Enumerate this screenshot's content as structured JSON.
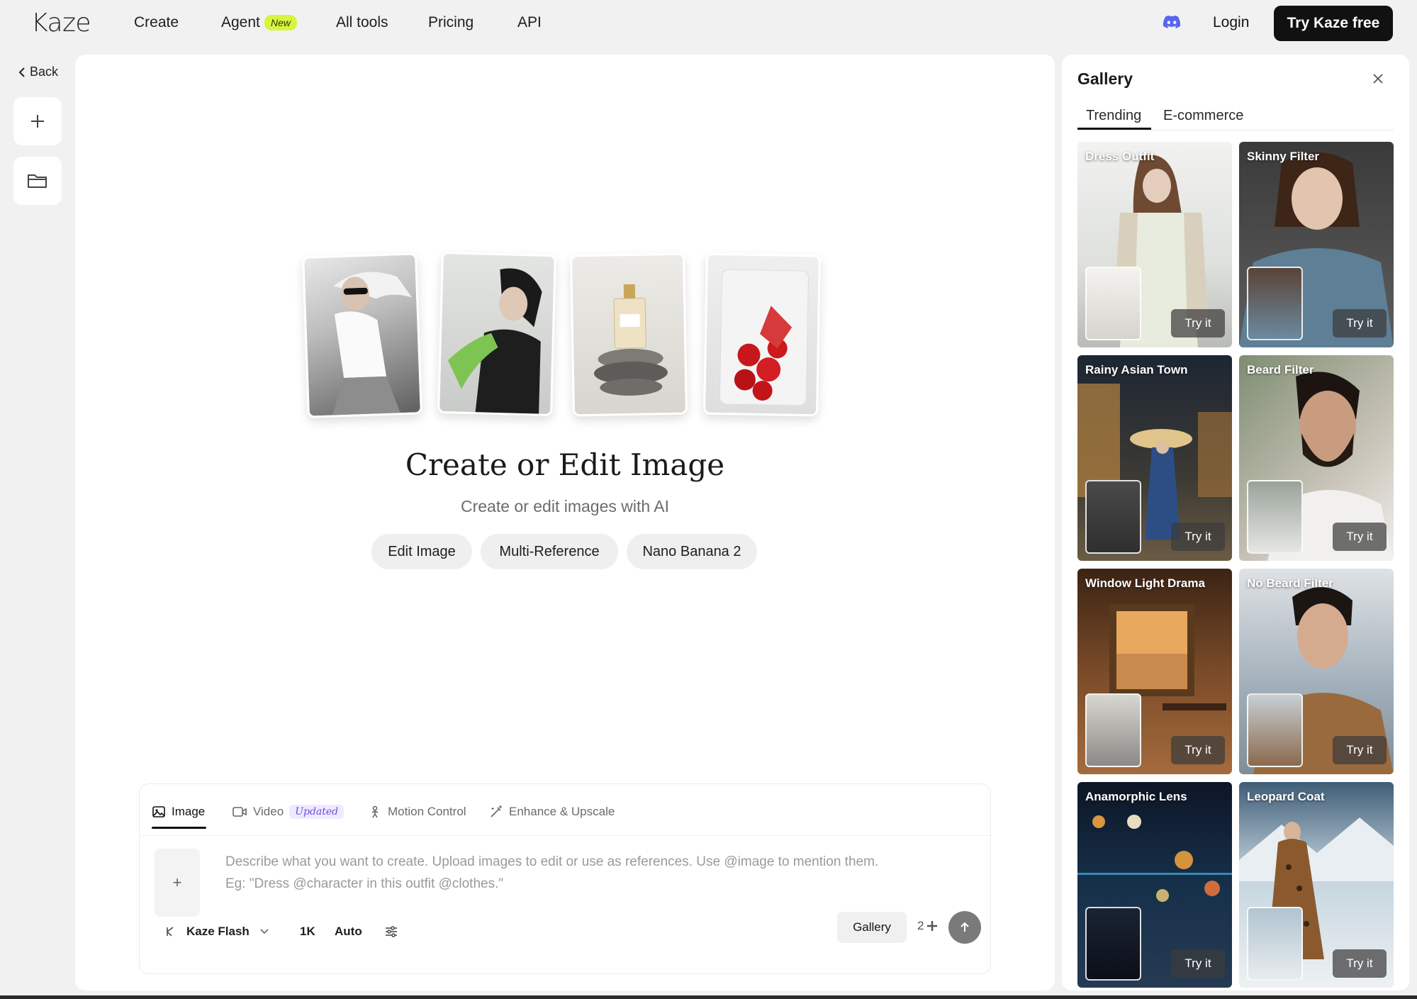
{
  "header": {
    "logo": "Kaze",
    "nav": [
      "Create",
      "Agent",
      "All tools",
      "Pricing",
      "API"
    ],
    "agent_badge": "New",
    "discord_icon": "discord-icon",
    "login": "Login",
    "cta": "Try Kaze free"
  },
  "rail": {
    "back": "Back",
    "new_icon": "plus-icon",
    "folder_icon": "folder-icon"
  },
  "hero": {
    "title": "Create or Edit Image",
    "subtitle": "Create or edit images with AI",
    "pills": [
      "Edit Image",
      "Multi-Reference",
      "Nano Banana 2"
    ]
  },
  "composer": {
    "tabs": [
      {
        "label": "Image",
        "icon": "image-icon"
      },
      {
        "label": "Video",
        "icon": "video-icon",
        "badge": "Updated"
      },
      {
        "label": "Motion Control",
        "icon": "motion-icon"
      },
      {
        "label": "Enhance & Upscale",
        "icon": "wand-icon"
      }
    ],
    "upload_label": "+",
    "prompt_line1": "Describe what you want to create. Upload images to edit or use as references. Use @image to mention them.",
    "prompt_line2": "Eg: \"Dress @character in this outfit @clothes.\"",
    "model": "Kaze Flash",
    "resolution": "1K",
    "aspect": "Auto",
    "gallery_label": "Gallery",
    "count": "2"
  },
  "gallery": {
    "title": "Gallery",
    "tabs": [
      "Trending",
      "E-commerce"
    ],
    "try_label": "Try it",
    "cards": [
      {
        "title": "Dress Outfit"
      },
      {
        "title": "Skinny Filter"
      },
      {
        "title": "Rainy Asian Town"
      },
      {
        "title": "Beard Filter"
      },
      {
        "title": "Window Light Drama"
      },
      {
        "title": "No Beard Filter"
      },
      {
        "title": "Anamorphic Lens"
      },
      {
        "title": "Leopard Coat"
      }
    ]
  }
}
